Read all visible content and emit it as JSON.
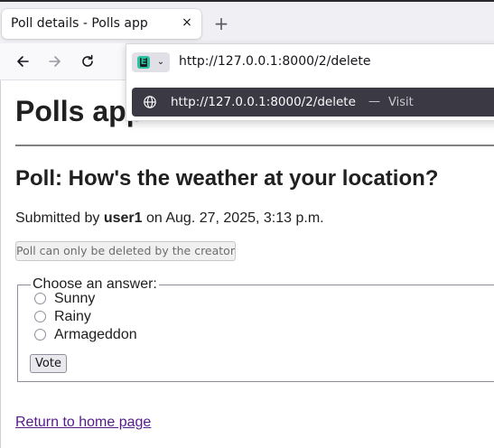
{
  "browser": {
    "tab": {
      "title": "Poll details - Polls app",
      "close_glyph": "×"
    },
    "new_tab_glyph": "+",
    "nav": {
      "back_icon": "arrow-left-icon",
      "forward_icon": "arrow-right-icon",
      "reload_icon": "reload-icon"
    },
    "address_bar": {
      "identity_badge": "E",
      "identity_chevron": "⌄",
      "value": "http://127.0.0.1:8000/2/delete"
    },
    "suggestion": {
      "url": "http://127.0.0.1:8000/2/delete",
      "separator": "—",
      "action": "Visit"
    }
  },
  "page": {
    "site_title": "Polls app",
    "poll_heading": "Poll: How's the weather at your location?",
    "submitted_prefix": "Submitted by",
    "submitted_user": "user1",
    "submitted_suffix": "on Aug. 27, 2025, 3:13 p.m.",
    "delete_button_label": "Poll can only be deleted by the creator",
    "form": {
      "legend": "Choose an answer:",
      "options": [
        "Sunny",
        "Rainy",
        "Armageddon"
      ],
      "vote_label": "Vote"
    },
    "home_link": "Return to home page"
  },
  "colors": {
    "suggestion_bg": "#3a3944",
    "link_visited": "#551a8b",
    "tabstrip_bg": "#f0f0f4"
  }
}
